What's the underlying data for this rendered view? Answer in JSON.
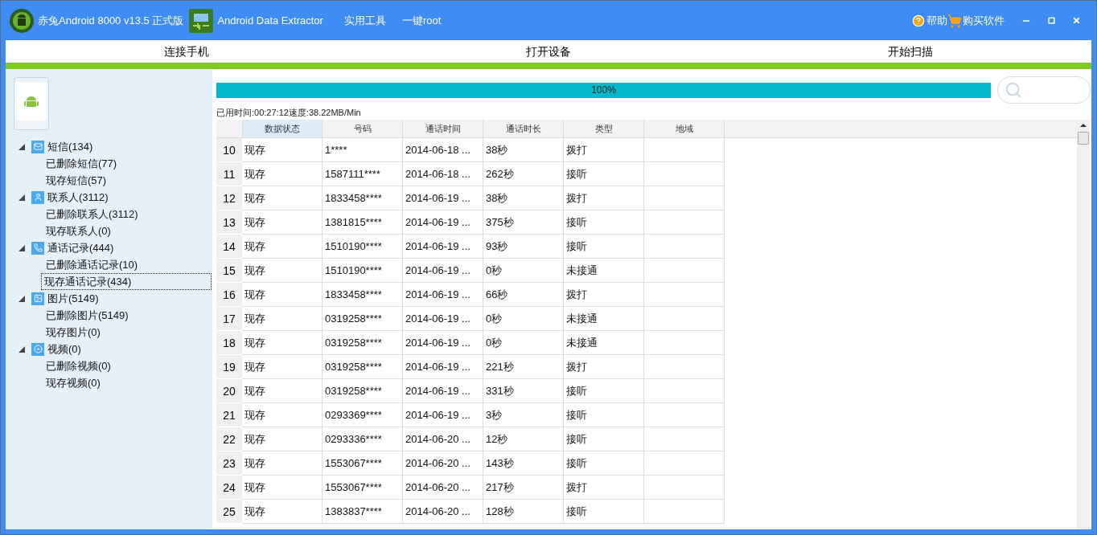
{
  "title_bar": {
    "app_title": "赤兔Android 8000 v13.5 正式版",
    "menu": [
      "Android Data Extractor",
      "实用工具",
      "一键root"
    ],
    "help": "帮助",
    "buy": "购买软件"
  },
  "nav_tabs": [
    "连接手机",
    "打开设备",
    "开始扫描"
  ],
  "tree": [
    {
      "kind": "sms",
      "label": "短信(134)",
      "expanded": true,
      "children": [
        {
          "label": "已删除短信(77)",
          "selected": false
        },
        {
          "label": "现存短信(57)",
          "selected": false
        }
      ]
    },
    {
      "kind": "contacts",
      "label": "联系人(3112)",
      "expanded": true,
      "children": [
        {
          "label": "已删除联系人(3112)",
          "selected": false
        },
        {
          "label": "现存联系人(0)",
          "selected": false
        }
      ]
    },
    {
      "kind": "calls",
      "label": "通话记录(444)",
      "expanded": true,
      "children": [
        {
          "label": "已删除通话记录(10)",
          "selected": false
        },
        {
          "label": "现存通话记录(434)",
          "selected": true
        }
      ]
    },
    {
      "kind": "pictures",
      "label": "图片(5149)",
      "expanded": true,
      "children": [
        {
          "label": "已删除图片(5149)",
          "selected": false
        },
        {
          "label": "现存图片(0)",
          "selected": false
        }
      ]
    },
    {
      "kind": "videos",
      "label": "视频(0)",
      "expanded": true,
      "children": [
        {
          "label": "已删除视频(0)",
          "selected": false
        },
        {
          "label": "现存视频(0)",
          "selected": false
        }
      ]
    }
  ],
  "progress": {
    "level": 1,
    "label": "100%"
  },
  "status": "已用时间:00:27:12速度:38.22MB/Min",
  "table": {
    "columns": [
      {
        "label": "数据状态",
        "selected": true
      },
      {
        "label": "号码",
        "selected": false
      },
      {
        "label": "通话时间",
        "selected": false
      },
      {
        "label": "通话时长",
        "selected": false
      },
      {
        "label": "类型",
        "selected": false
      },
      {
        "label": "地域",
        "selected": false
      }
    ],
    "rows": [
      {
        "number": "10",
        "cells": [
          "现存",
          "1****",
          "2014-06-18 ...",
          "38秒",
          "拨打"
        ]
      },
      {
        "number": "11",
        "cells": [
          "现存",
          "1587111****",
          "2014-06-18 ...",
          "262秒",
          "接听"
        ]
      },
      {
        "number": "12",
        "cells": [
          "现存",
          "1833458****",
          "2014-06-19 ...",
          "38秒",
          "拨打"
        ]
      },
      {
        "number": "13",
        "cells": [
          "现存",
          "1381815****",
          "2014-06-19 ...",
          "375秒",
          "接听"
        ]
      },
      {
        "number": "14",
        "cells": [
          "现存",
          "1510190****",
          "2014-06-19 ...",
          "93秒",
          "接听"
        ]
      },
      {
        "number": "15",
        "cells": [
          "现存",
          "1510190****",
          "2014-06-19 ...",
          "0秒",
          "未接通"
        ]
      },
      {
        "number": "16",
        "cells": [
          "现存",
          "1833458****",
          "2014-06-19 ...",
          "66秒",
          "拨打"
        ]
      },
      {
        "number": "17",
        "cells": [
          "现存",
          "0319258****",
          "2014-06-19 ...",
          "0秒",
          "未接通"
        ]
      },
      {
        "number": "18",
        "cells": [
          "现存",
          "0319258****",
          "2014-06-19 ...",
          "0秒",
          "未接通"
        ]
      },
      {
        "number": "19",
        "cells": [
          "现存",
          "0319258****",
          "2014-06-19 ...",
          "221秒",
          "拨打"
        ]
      },
      {
        "number": "20",
        "cells": [
          "现存",
          "0319258****",
          "2014-06-19 ...",
          "331秒",
          "接听"
        ]
      },
      {
        "number": "21",
        "cells": [
          "现存",
          "0293369****",
          "2014-06-19 ...",
          "3秒",
          "接听"
        ]
      },
      {
        "number": "22",
        "cells": [
          "现存",
          "0293336****",
          "2014-06-20 ...",
          "12秒",
          "接听"
        ]
      },
      {
        "number": "23",
        "cells": [
          "现存",
          "1553067****",
          "2014-06-20 ...",
          "143秒",
          "接听"
        ]
      },
      {
        "number": "24",
        "cells": [
          "现存",
          "1553067****",
          "2014-06-20 ...",
          "217秒",
          "拨打"
        ]
      },
      {
        "number": "25",
        "cells": [
          "现存",
          "1383837****",
          "2014-06-20 ...",
          "128秒",
          "接听"
        ]
      }
    ]
  }
}
